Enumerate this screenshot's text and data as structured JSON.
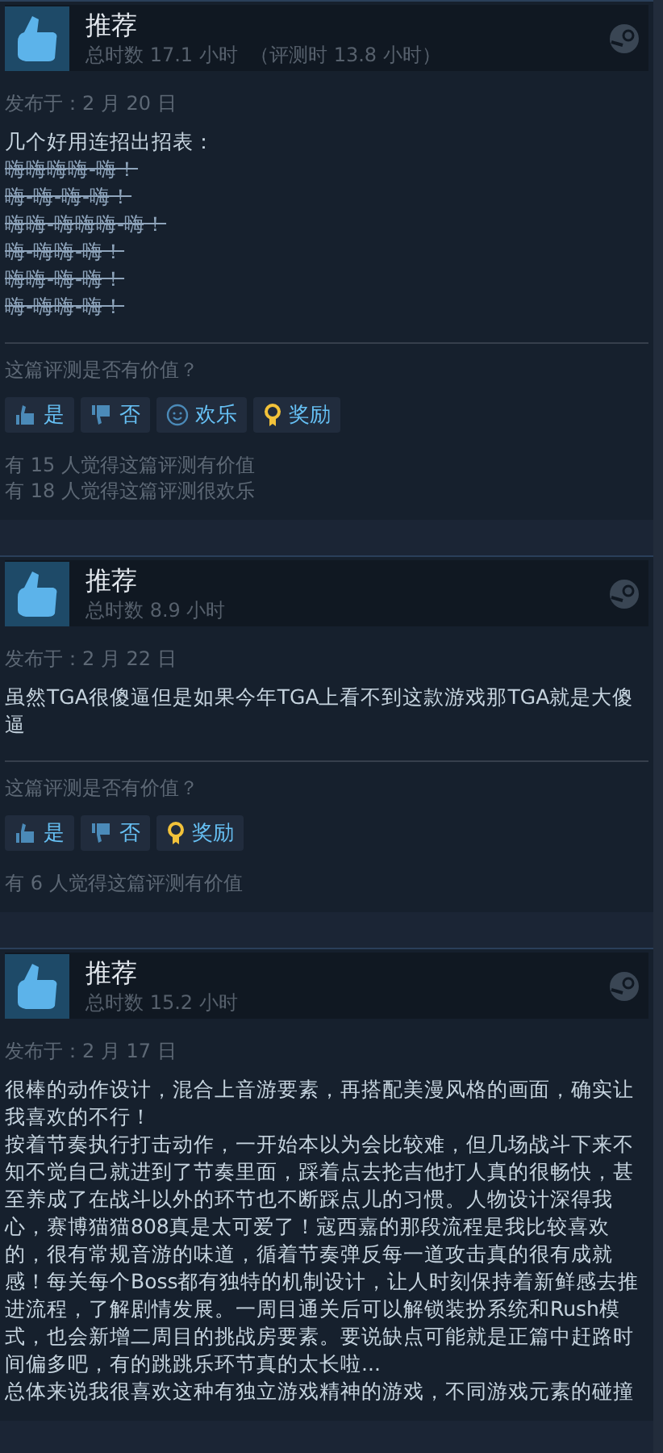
{
  "reviews": [
    {
      "verdict": "推荐",
      "hours": "总时数 17.1 小时",
      "review_hours": "（评测时 13.8 小时）",
      "date": "发布于：2 月 20 日",
      "body": [
        {
          "kind": "plain",
          "text": "几个好用连招出招表："
        },
        {
          "kind": "strike",
          "text": "嗨嗨嗨嗨-嗨！"
        },
        {
          "kind": "strike",
          "text": "嗨-嗨-嗨-嗨！"
        },
        {
          "kind": "strike",
          "text": "嗨嗨-嗨嗨嗨-嗨！"
        },
        {
          "kind": "strike",
          "text": "嗨-嗨嗨-嗨！"
        },
        {
          "kind": "strike",
          "text": "嗨嗨-嗨-嗨！"
        },
        {
          "kind": "strike",
          "text": "嗨-嗨嗨-嗨！"
        }
      ],
      "question": "这篇评测是否有价值？",
      "buttons": [
        {
          "kind": "up",
          "label": "是"
        },
        {
          "kind": "down",
          "label": "否"
        },
        {
          "kind": "funny",
          "label": "欢乐"
        },
        {
          "kind": "award",
          "label": "奖励"
        }
      ],
      "counts": [
        "有 15 人觉得这篇评测有价值",
        "有 18 人觉得这篇评测很欢乐"
      ]
    },
    {
      "verdict": "推荐",
      "hours": "总时数 8.9 小时",
      "date": "发布于：2 月 22 日",
      "body": [
        {
          "kind": "plain",
          "text": "虽然TGA很傻逼但是如果今年TGA上看不到这款游戏那TGA就是大傻逼"
        }
      ],
      "question": "这篇评测是否有价值？",
      "buttons": [
        {
          "kind": "up",
          "label": "是"
        },
        {
          "kind": "down",
          "label": "否"
        },
        {
          "kind": "award",
          "label": "奖励"
        }
      ],
      "counts": [
        "有 6 人觉得这篇评测有价值"
      ]
    },
    {
      "verdict": "推荐",
      "hours": "总时数 15.2 小时",
      "date": "发布于：2 月 17 日",
      "body": [
        {
          "kind": "plain",
          "text": "很棒的动作设计，混合上音游要素，再搭配美漫风格的画面，确实让我喜欢的不行！"
        },
        {
          "kind": "plain",
          "text": "按着节奏执行打击动作，一开始本以为会比较难，但几场战斗下来不知不觉自己就进到了节奏里面，踩着点去抡吉他打人真的很畅快，甚至养成了在战斗以外的环节也不断踩点儿的习惯。人物设计深得我心，赛博猫猫808真是太可爱了！寇西嘉的那段流程是我比较喜欢的，很有常规音游的味道，循着节奏弹反每一道攻击真的很有成就感！每关每个Boss都有独特的机制设计，让人时刻保持着新鲜感去推进流程，了解剧情发展。一周目通关后可以解锁装扮系统和Rush模式，也会新增二周目的挑战房要素。要说缺点可能就是正篇中赶路时间偏多吧，有的跳跳乐环节真的太长啦..."
        },
        {
          "kind": "plain",
          "text": "总体来说我很喜欢这种有独立游戏精神的游戏，不同游戏元素的碰撞"
        }
      ]
    }
  ]
}
